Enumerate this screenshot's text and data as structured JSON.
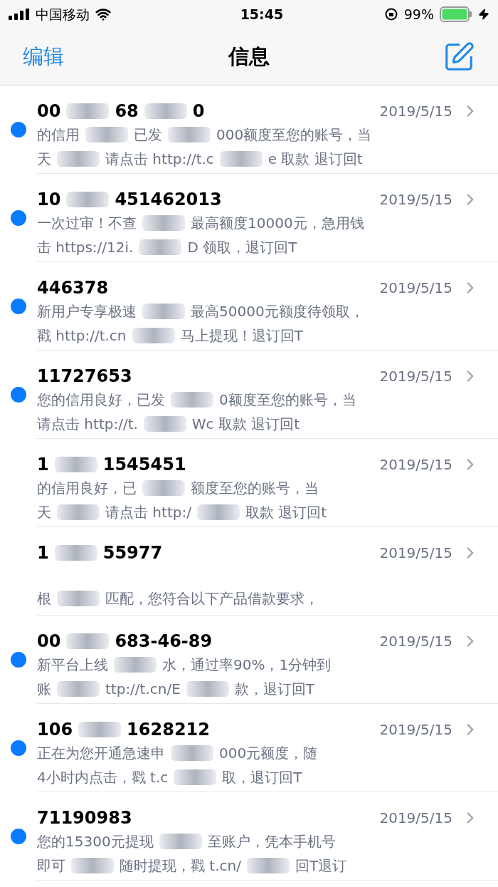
{
  "status_bar": {
    "carrier": "中国移动",
    "time": "15:45",
    "battery": "99%"
  },
  "nav": {
    "edit": "编辑",
    "title": "信息"
  },
  "messages": [
    {
      "unread": true,
      "sender": [
        "00",
        "68",
        "0"
      ],
      "date": "2019/5/15",
      "lines": [
        [
          "的信用",
          "已发",
          "000额度至您的账号，当"
        ],
        [
          "天",
          "请点击 http://t.c",
          "e  取款 退订回t"
        ]
      ]
    },
    {
      "unread": true,
      "sender": [
        "10",
        "451462013"
      ],
      "date": "2019/5/15",
      "lines": [
        [
          "一次过审！不查",
          "最高额度10000元，急用钱"
        ],
        [
          "击 https://12i.",
          "D 领取，退订回T"
        ]
      ]
    },
    {
      "unread": true,
      "sender": [
        "446378"
      ],
      "date": "2019/5/15",
      "lines": [
        [
          "新用户专享极速",
          "最高50000元额度待领取，"
        ],
        [
          "戳 http://t.cn",
          "马上提现！退订回T"
        ]
      ]
    },
    {
      "unread": true,
      "sender": [
        "11727653"
      ],
      "date": "2019/5/15",
      "lines": [
        [
          "您的信用良好，已发",
          "0额度至您的账号，当"
        ],
        [
          "请点击  http://t.",
          "Wc  取款 退订回t"
        ]
      ]
    },
    {
      "unread": false,
      "sender": [
        "1",
        "1545451"
      ],
      "date": "2019/5/15",
      "lines": [
        [
          "的信用良好，已",
          "额度至您的账号，当"
        ],
        [
          "天",
          "请点击  http:/",
          "取款 退订回t"
        ]
      ]
    },
    {
      "unread": false,
      "sender": [
        "1",
        "55977"
      ],
      "date": "2019/5/15",
      "lines": [
        [
          "根",
          "匹配，您符合以下产品借款要求，"
        ]
      ]
    },
    {
      "unread": true,
      "sender": [
        "00",
        "683-46-89"
      ],
      "date": "2019/5/15",
      "lines": [
        [
          "新平台上线",
          "水，通过率90%，1分钟到"
        ],
        [
          "账",
          "ttp://t.cn/E",
          "款，退订回T"
        ]
      ]
    },
    {
      "unread": true,
      "sender": [
        "106",
        "1628212"
      ],
      "date": "2019/5/15",
      "lines": [
        [
          "正在为您开通急速申",
          "000元额度，随"
        ],
        [
          "4小时内点击，戳 t.c",
          "取，退订回T"
        ]
      ]
    },
    {
      "unread": true,
      "sender": [
        "71190983"
      ],
      "date": "2019/5/15",
      "lines": [
        [
          "您的15300元提现",
          "至账户，凭本手机号"
        ],
        [
          "即可",
          "随时提现，戳 t.cn/",
          "回T退订"
        ]
      ]
    }
  ]
}
